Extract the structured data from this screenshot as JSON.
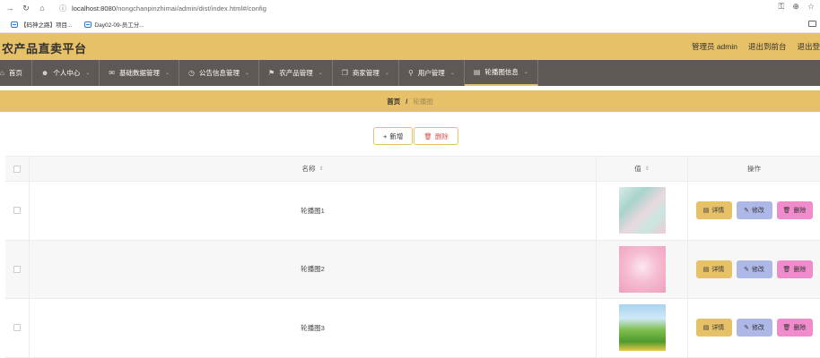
{
  "browser": {
    "url_host": "localhost:8080",
    "url_path": "/nongchanpinzhimai/admin/dist/index.html#/config",
    "bookmarks": [
      {
        "label": "【码神之路】项目..."
      },
      {
        "label": "Day02-09-员工分..."
      }
    ]
  },
  "header": {
    "title": "农产品直卖平台",
    "user": "管理员 admin",
    "to_front": "退出到前台",
    "logout": "退出登"
  },
  "nav": {
    "items": [
      {
        "label": "首页"
      },
      {
        "label": "个人中心"
      },
      {
        "label": "基础数据管理"
      },
      {
        "label": "公告信息管理"
      },
      {
        "label": "农产品管理"
      },
      {
        "label": "商家管理"
      },
      {
        "label": "用户管理"
      },
      {
        "label": "轮播图信息"
      }
    ]
  },
  "breadcrumb": {
    "home": "首页",
    "sep": "/",
    "current": "轮播图"
  },
  "toolbar": {
    "add_label": "新增",
    "delete_label": "删除"
  },
  "table": {
    "columns": {
      "name": "名称",
      "value": "值",
      "ops": "操作"
    },
    "rows": [
      {
        "name": "轮播图1"
      },
      {
        "name": "轮播图2"
      },
      {
        "name": "轮播图3"
      }
    ],
    "op_labels": {
      "detail": "详情",
      "edit": "修改",
      "delete": "删除"
    }
  },
  "colors": {
    "accent": "#e7c168",
    "nav_bg": "#5e5955",
    "edit_btn": "#aeb8e6",
    "delete_btn": "#f08ccc"
  }
}
